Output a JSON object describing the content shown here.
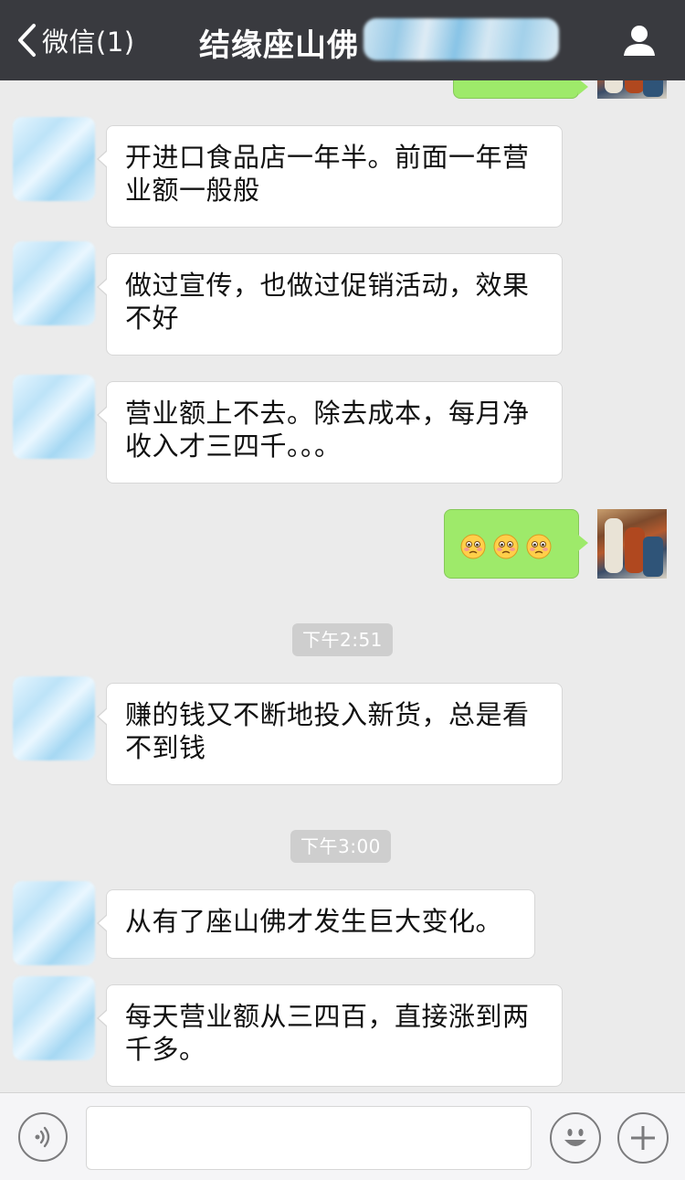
{
  "header": {
    "back_label": "微信(1)",
    "title": "结缘座山佛"
  },
  "messages": [
    {
      "type": "text",
      "side": "left",
      "text": "开进口食品店一年半。前面一年营业额一般般"
    },
    {
      "type": "text",
      "side": "left",
      "text": "做过宣传，也做过促销活动，效果不好"
    },
    {
      "type": "text",
      "side": "left",
      "text": "营业额上不去。除去成本，每月净收入才三四千。。。"
    },
    {
      "type": "emoji",
      "side": "right",
      "emojis": [
        "worried-face-icon",
        "worried-face-icon",
        "worried-face-icon"
      ]
    },
    {
      "type": "time",
      "text": "下午2:51"
    },
    {
      "type": "text",
      "side": "left",
      "text": "赚的钱又不断地投入新货，总是看不到钱"
    },
    {
      "type": "time",
      "text": "下午3:00"
    },
    {
      "type": "text",
      "side": "left",
      "text": "从有了座山佛才发生巨大变化。"
    },
    {
      "type": "text",
      "side": "left",
      "text": "每天营业额从三四百，直接涨到两千多。"
    }
  ],
  "input_bar": {
    "voice_icon": "voice-icon",
    "emoji_icon": "smiley-icon",
    "plus_icon": "plus-icon",
    "value": ""
  },
  "colors": {
    "header_bg": "#393a3f",
    "chat_bg": "#ebebeb",
    "bubble_self": "#9eea6a",
    "bubble_other": "#ffffff",
    "time_badge": "#cecece"
  }
}
